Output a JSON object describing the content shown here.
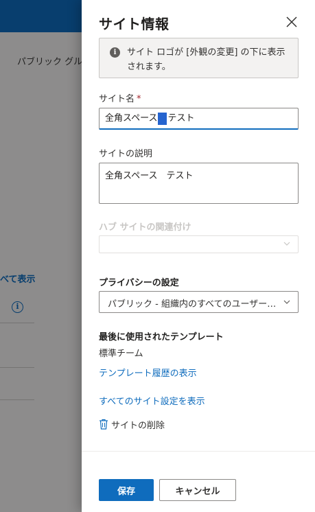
{
  "background": {
    "public_group_text": "パブリック グル",
    "show_all_link": "べて表示",
    "info_icon": "info-icon"
  },
  "panel": {
    "title": "サイト情報",
    "close_icon": "close-icon",
    "info_bar": {
      "icon": "info-icon",
      "text": "サイト ロゴが [外観の変更] の下に表示されます。"
    },
    "site_name": {
      "label": "サイト名",
      "required_marker": "*",
      "value_part1": "全角スペース",
      "value_part2": "テスト"
    },
    "site_description": {
      "label": "サイトの説明",
      "value": "全角スペース　テスト"
    },
    "hub_association": {
      "label": "ハブ サイトの関連付け",
      "value": ""
    },
    "privacy": {
      "label": "プライバシーの設定",
      "value": "パブリック - 組織内のすべてのユーザーがこのサイトにアクセスできます"
    },
    "template": {
      "heading": "最後に使用されたテンプレート",
      "name": "標準チーム",
      "history_link": "テンプレート履歴の表示"
    },
    "all_settings_link": "すべてのサイト設定を表示",
    "delete_label": "サイトの削除",
    "buttons": {
      "save": "保存",
      "cancel": "キャンセル"
    }
  },
  "colors": {
    "accent": "#0f6cbd",
    "required": "#a4262c",
    "overlay": "rgba(0,0,0,0.42)"
  }
}
